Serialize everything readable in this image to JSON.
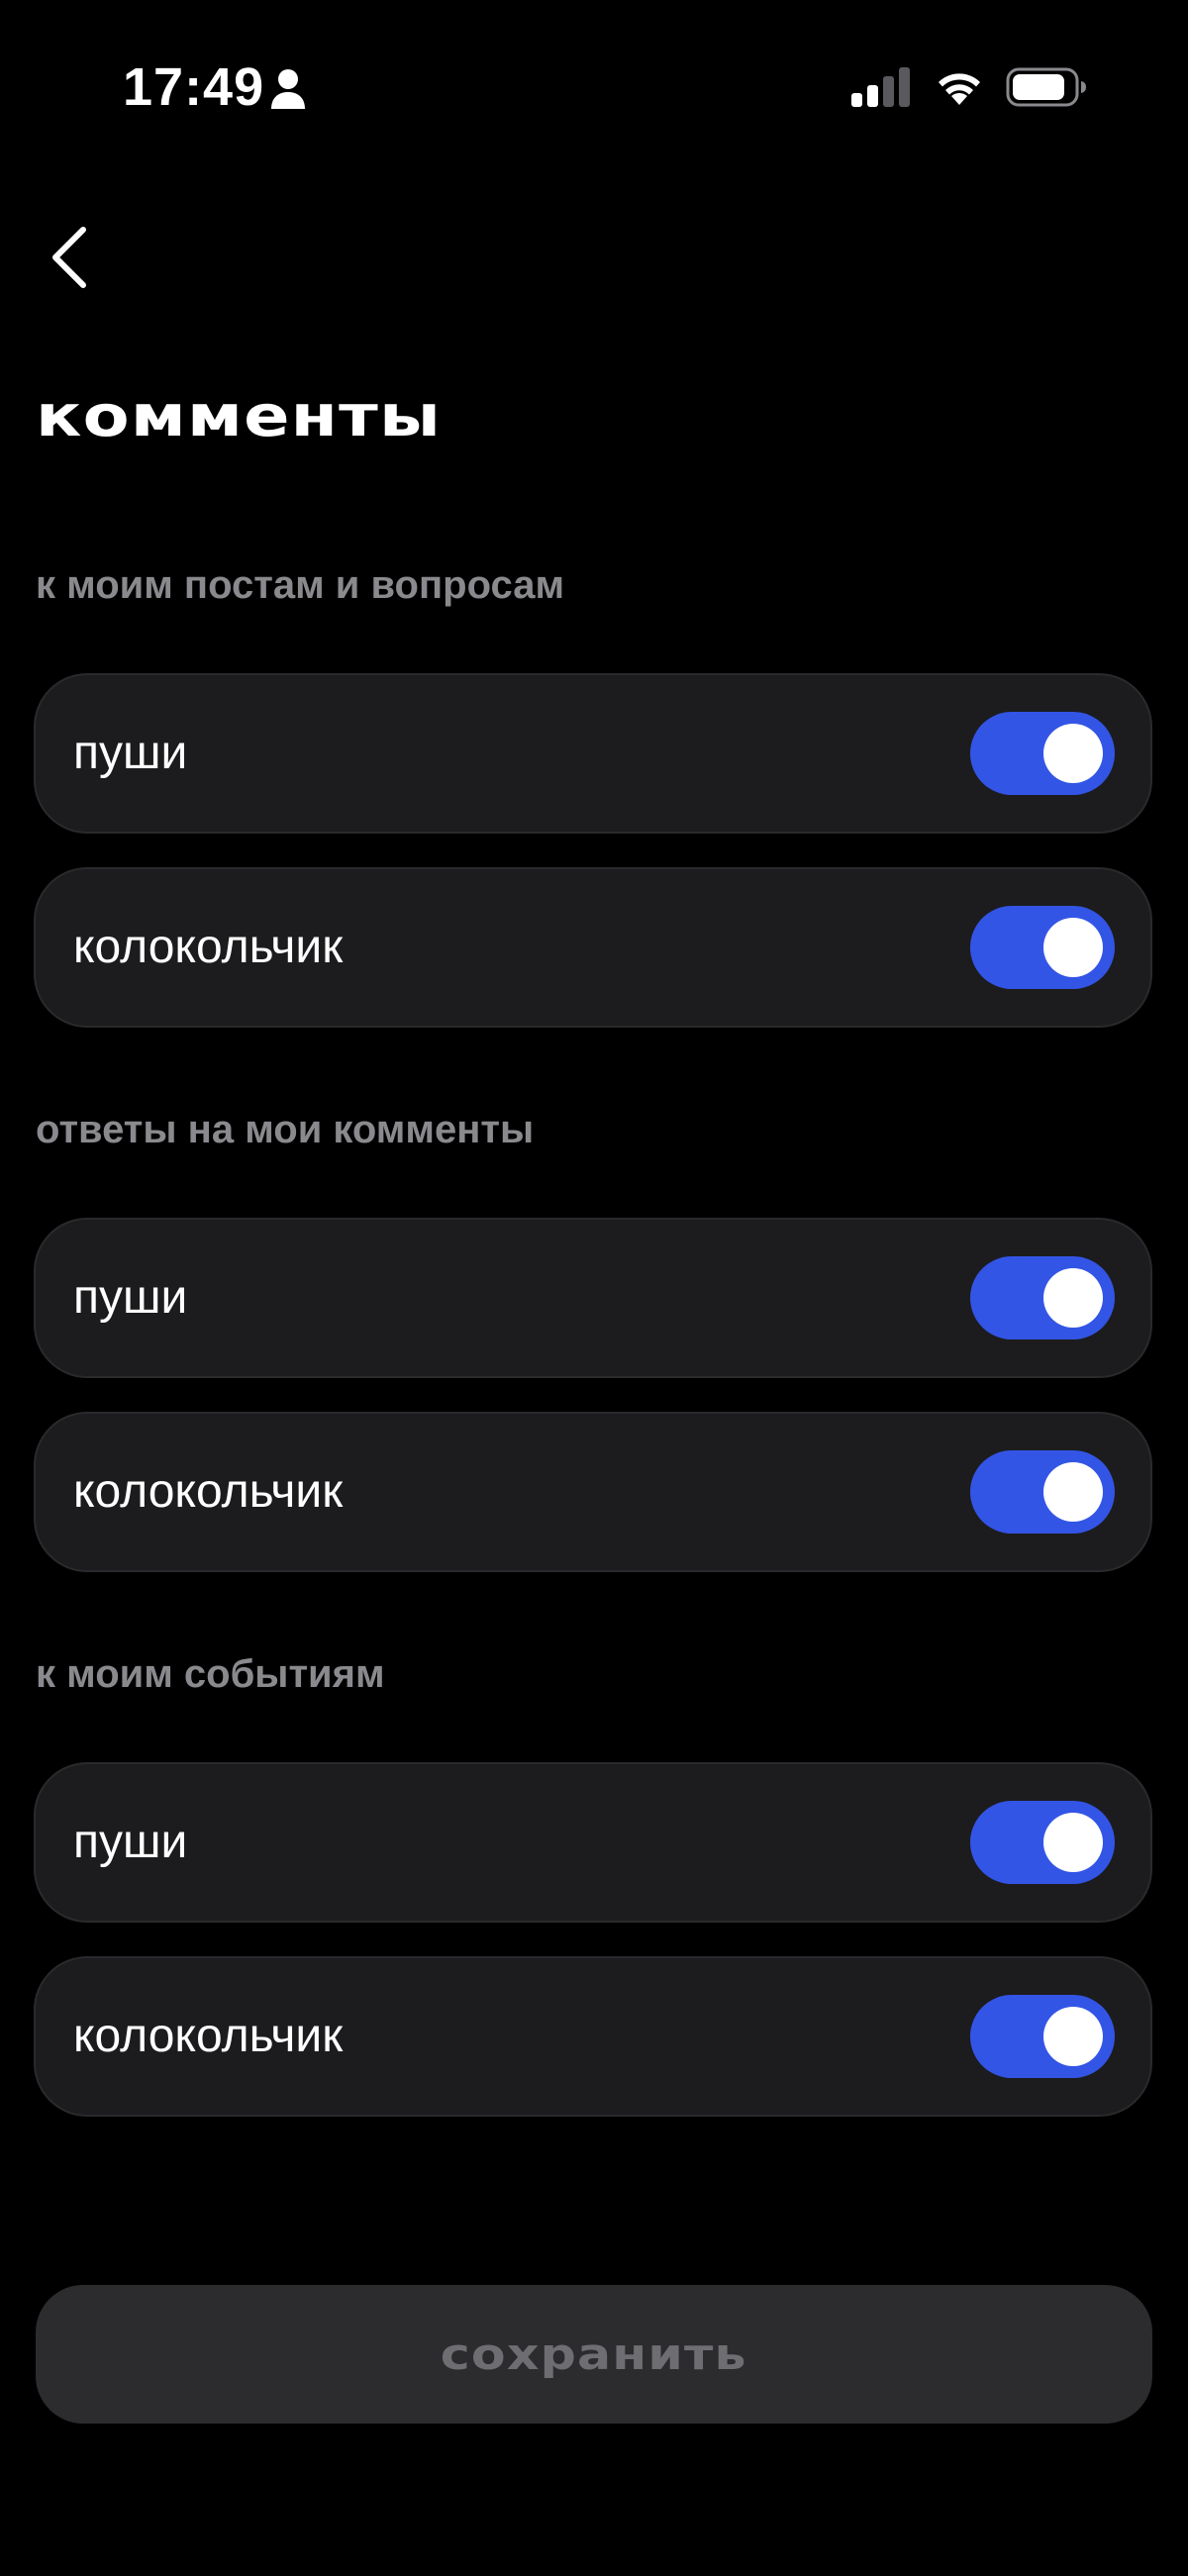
{
  "status_bar": {
    "time": "17:49",
    "icons": [
      "person-icon",
      "cellular-signal-icon",
      "wifi-icon",
      "battery-icon"
    ]
  },
  "header": {
    "back_icon": "chevron-left-icon",
    "title": "комменты"
  },
  "colors": {
    "background": "#000000",
    "row_background": "#1c1c1e",
    "toggle_on": "#3355e6",
    "section_label": "#8a8a8e",
    "save_button_bg": "#2c2c2e",
    "save_button_text": "#6e6e72"
  },
  "sections": [
    {
      "label": "к моим постам и вопросам",
      "rows": [
        {
          "label": "пуши",
          "enabled": true
        },
        {
          "label": "колокольчик",
          "enabled": true
        }
      ]
    },
    {
      "label": "ответы на мои комменты",
      "rows": [
        {
          "label": "пуши",
          "enabled": true
        },
        {
          "label": "колокольчик",
          "enabled": true
        }
      ]
    },
    {
      "label": "к моим событиям",
      "rows": [
        {
          "label": "пуши",
          "enabled": true
        },
        {
          "label": "колокольчик",
          "enabled": true
        }
      ]
    }
  ],
  "footer": {
    "save_label": "сохранить"
  }
}
